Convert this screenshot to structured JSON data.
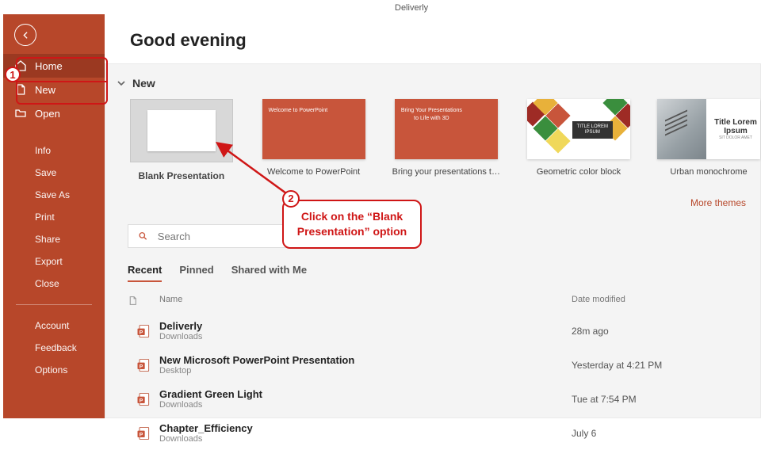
{
  "top_hint": "Deliverly",
  "greeting": "Good evening",
  "sidebar": {
    "items": [
      {
        "label": "Home"
      },
      {
        "label": "New"
      },
      {
        "label": "Open"
      }
    ],
    "sub1": [
      {
        "label": "Info"
      },
      {
        "label": "Save"
      },
      {
        "label": "Save As"
      },
      {
        "label": "Print"
      },
      {
        "label": "Share"
      },
      {
        "label": "Export"
      },
      {
        "label": "Close"
      }
    ],
    "sub2": [
      {
        "label": "Account"
      },
      {
        "label": "Feedback"
      },
      {
        "label": "Options"
      }
    ]
  },
  "section_new": "New",
  "templates": [
    {
      "caption": "Blank Presentation"
    },
    {
      "caption": "Welcome to PowerPoint",
      "line1": "Welcome to PowerPoint"
    },
    {
      "caption": "Bring your presentations t…",
      "line1": "Bring Your Presentations",
      "line2": "to Life with 3D"
    },
    {
      "caption": "Geometric color block",
      "tag1": "TITLE LOREM",
      "tag2": "IPSUM"
    },
    {
      "caption": "Urban monochrome",
      "t1": "Title Lorem",
      "t2": "Ipsum",
      "t3": "SIT DOLOR AMET"
    }
  ],
  "more_themes": "More themes",
  "search": {
    "placeholder": "Search"
  },
  "tabs": [
    {
      "label": "Recent"
    },
    {
      "label": "Pinned"
    },
    {
      "label": "Shared with Me"
    }
  ],
  "list": {
    "col_name": "Name",
    "col_date": "Date modified",
    "rows": [
      {
        "name": "Deliverly",
        "loc": "Downloads",
        "date": "28m ago"
      },
      {
        "name": "New Microsoft PowerPoint Presentation",
        "loc": "Desktop",
        "date": "Yesterday at 4:21 PM"
      },
      {
        "name": "Gradient Green Light",
        "loc": "Downloads",
        "date": "Tue at 7:54 PM"
      },
      {
        "name": "Chapter_Efficiency",
        "loc": "Downloads",
        "date": "July 6"
      }
    ]
  },
  "annotations": {
    "step1_num": "1",
    "step2_num": "2",
    "step2_text": "Click on the “Blank Presentation” option"
  }
}
